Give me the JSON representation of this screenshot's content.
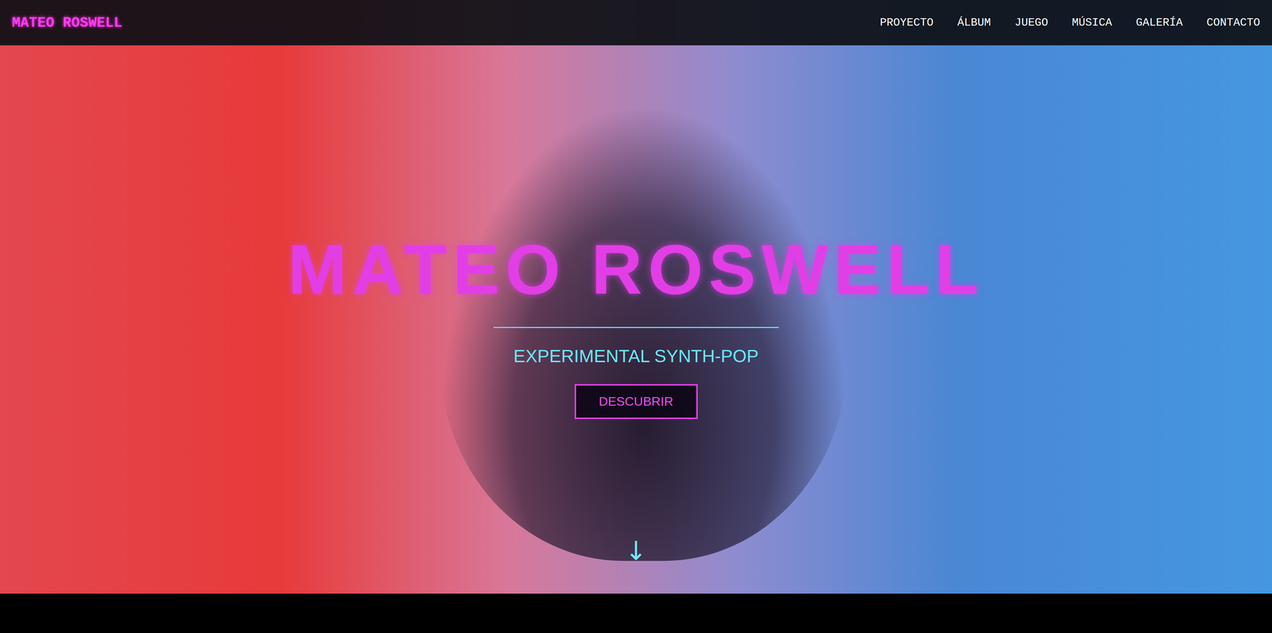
{
  "nav": {
    "logo": "MATEO ROSWELL",
    "items": [
      {
        "label": "PROYECTO",
        "selected": false
      },
      {
        "label": "ÁLBUM",
        "selected": false
      },
      {
        "label": "JUEGO",
        "selected": false
      },
      {
        "label": "MÚSICA",
        "selected": false
      },
      {
        "label": "GALERÍA",
        "selected": false
      },
      {
        "label": "CONTACTO",
        "selected": false
      }
    ]
  },
  "hero": {
    "title": "MATEO ROSWELL",
    "subtitle": "EXPERIMENTAL SYNTH-POP",
    "button": "DESCUBRIR",
    "scroll_icon": "↓"
  }
}
